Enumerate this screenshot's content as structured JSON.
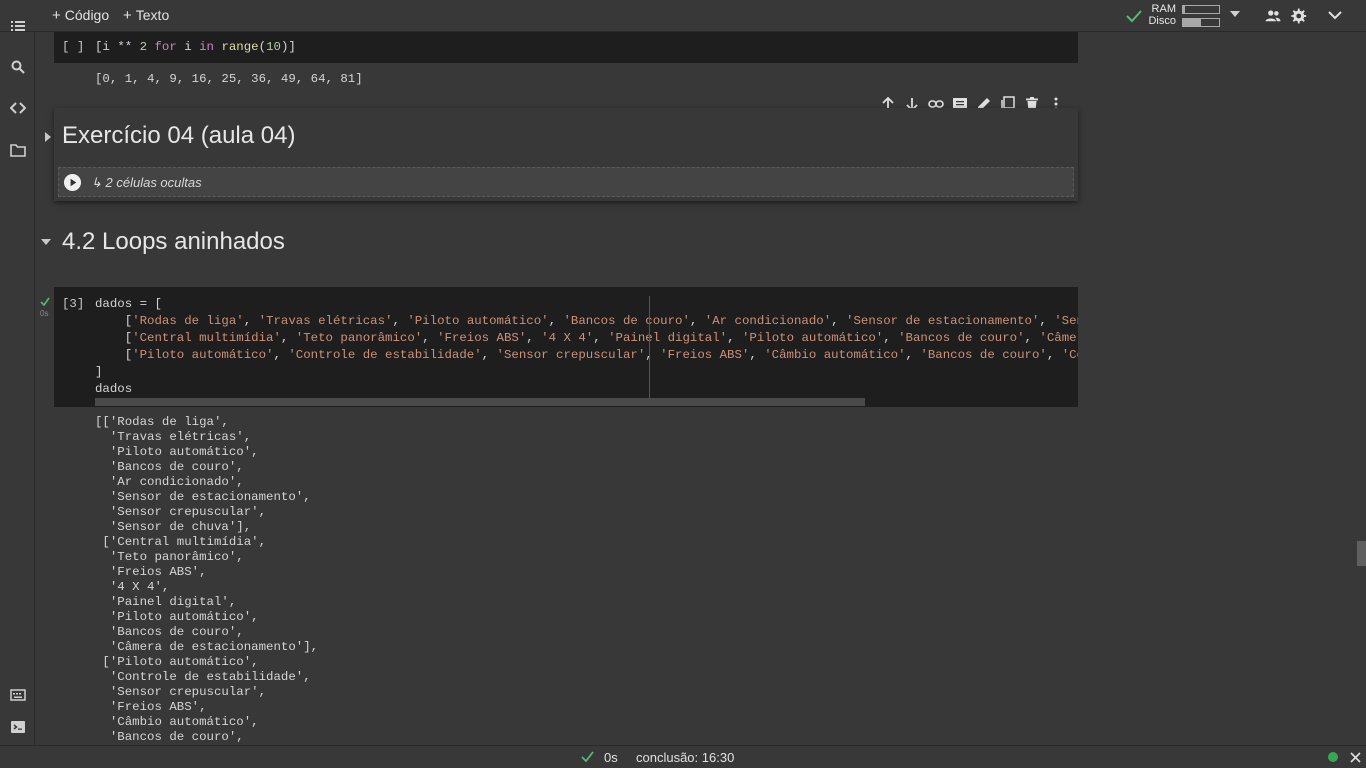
{
  "toolbar": {
    "add_code": "Código",
    "add_text": "Texto",
    "ram_label": "RAM",
    "disk_label": "Disco",
    "ram_usage": 0.05,
    "disk_usage": 0.5
  },
  "cells": {
    "squares": {
      "exec_label": "[ ]",
      "code": "[i ** 2 for i in range(10)]",
      "output": "[0, 1, 4, 9, 16, 25, 36, 49, 64, 81]"
    },
    "section_04": {
      "heading": "Exercício 04 (aula 04)",
      "hidden_label": "2 células ocultas"
    },
    "section_42": {
      "heading": "4.2 Loops aninhados"
    },
    "dados": {
      "exec_label": "[3]",
      "status_time": "0s",
      "code_lines": [
        "dados = [",
        "    ['Rodas de liga', 'Travas elétricas', 'Piloto automático', 'Bancos de couro', 'Ar condicionado', 'Sensor de estacionamento', 'Sensor crep",
        "    ['Central multimídia', 'Teto panorâmico', 'Freios ABS', '4 X 4', 'Painel digital', 'Piloto automático', 'Bancos de couro', 'Câmera de est",
        "    ['Piloto automático', 'Controle de estabilidade', 'Sensor crepuscular', 'Freios ABS', 'Câmbio automático', 'Bancos de couro', 'Central mu",
        "]",
        "dados"
      ],
      "output_lines": [
        "[['Rodas de liga',",
        "  'Travas elétricas',",
        "  'Piloto automático',",
        "  'Bancos de couro',",
        "  'Ar condicionado',",
        "  'Sensor de estacionamento',",
        "  'Sensor crepuscular',",
        "  'Sensor de chuva'],",
        " ['Central multimídia',",
        "  'Teto panorâmico',",
        "  'Freios ABS',",
        "  '4 X 4',",
        "  'Painel digital',",
        "  'Piloto automático',",
        "  'Bancos de couro',",
        "  'Câmera de estacionamento'],",
        " ['Piloto automático',",
        "  'Controle de estabilidade',",
        "  'Sensor crepuscular',",
        "  'Freios ABS',",
        "  'Câmbio automático',",
        "  'Bancos de couro',"
      ]
    }
  },
  "statusbar": {
    "duration": "0s",
    "completion": "conclusão: 16:30"
  },
  "colors": {
    "accent_green": "#5bb974",
    "status_dot": "#34a853"
  }
}
